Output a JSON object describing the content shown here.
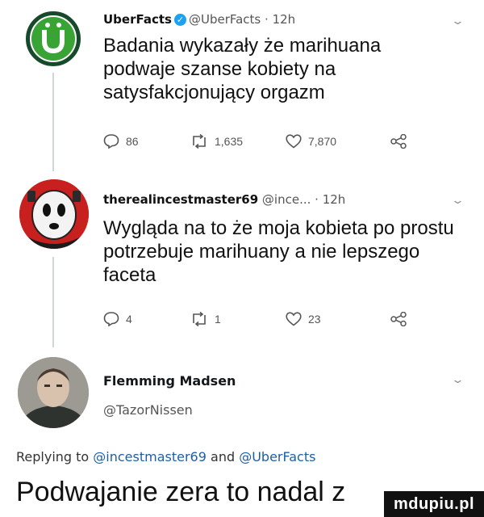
{
  "tweets": [
    {
      "name": "UberFacts",
      "handle": "@UberFacts",
      "time": "· 12h",
      "text": "Badania wykazały że marihuana podwaje szanse kobiety na satysfakcjonujący orgazm",
      "replies": "86",
      "retweets": "1,635",
      "likes": "7,870"
    },
    {
      "name": "therealincestmaster69",
      "handle": "@ince...",
      "time": "· 12h",
      "text": "Wygląda na to że moja kobieta po prostu potrzebuje marihuany a nie lepszego faceta",
      "replies": "4",
      "retweets": "1",
      "likes": "23"
    },
    {
      "name": "Flemming Madsen",
      "handle": "@TazorNissen"
    }
  ],
  "replying_to": {
    "prefix": "Replying to",
    "user1": "@incestmaster69",
    "and": "and",
    "user2": "@UberFacts"
  },
  "caption": "Podwajanie zera to nadal z",
  "watermark": "mdupiu.pl",
  "colors": {
    "uberfacts_green": "#3aa335",
    "verified_blue": "#1da1f2",
    "thread_line": "#cfd5da"
  },
  "icons": [
    "reply-icon",
    "retweet-icon",
    "like-icon",
    "share-icon",
    "chevron-down-icon",
    "verified-icon"
  ]
}
